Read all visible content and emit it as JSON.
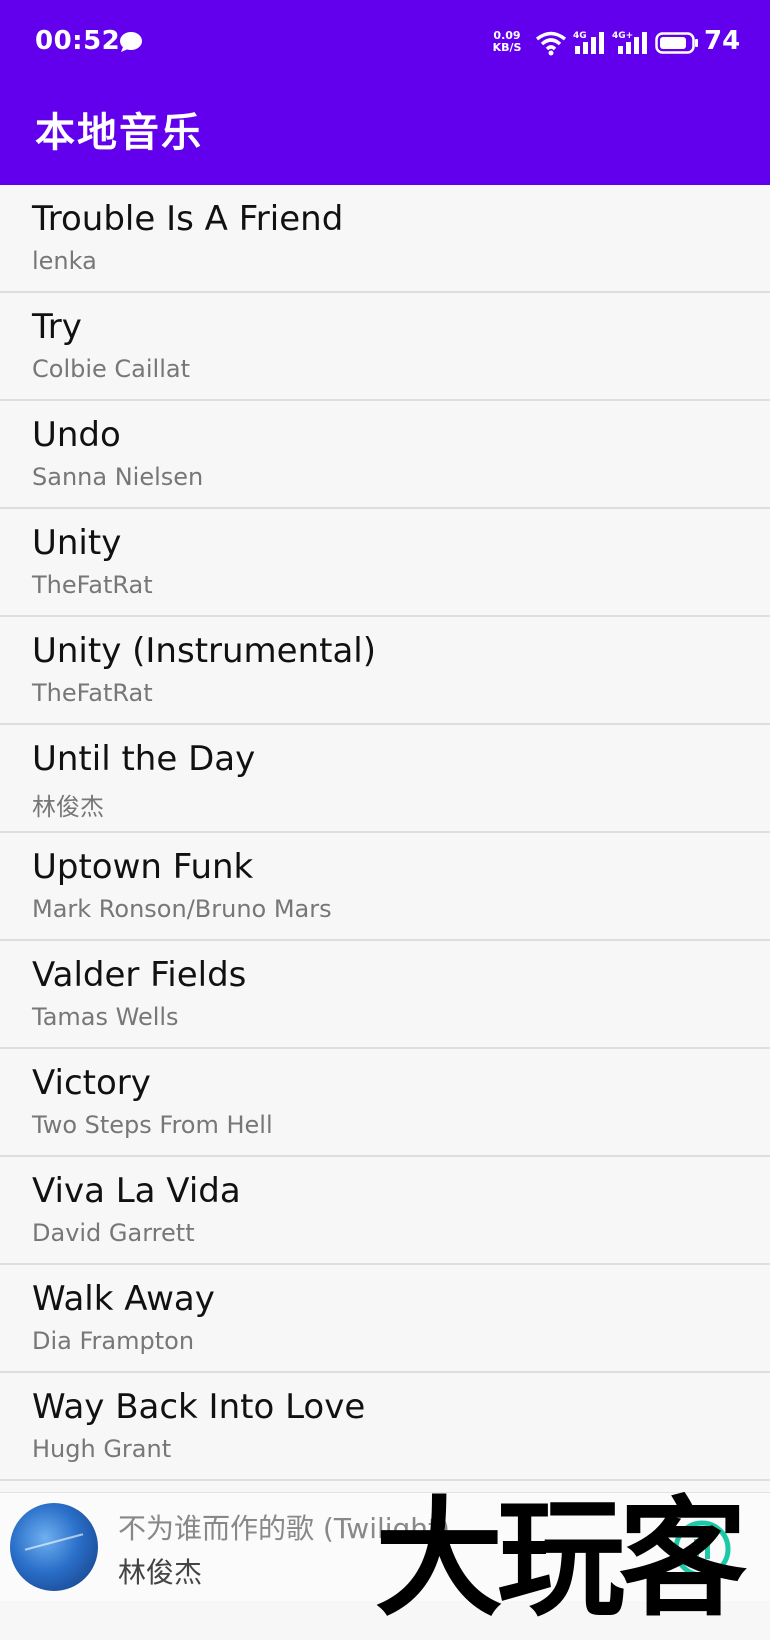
{
  "status_bar": {
    "time": "00:52",
    "net_speed_value": "0.09",
    "net_speed_unit": "KB/S",
    "signal1_label": "4G",
    "signal2_label": "4G+",
    "battery_level": "74"
  },
  "app_bar": {
    "title": "本地音乐"
  },
  "songs": [
    {
      "title": "Trouble Is A Friend",
      "artist": "lenka"
    },
    {
      "title": "Try",
      "artist": "Colbie Caillat"
    },
    {
      "title": "Undo",
      "artist": "Sanna Nielsen"
    },
    {
      "title": "Unity",
      "artist": "TheFatRat"
    },
    {
      "title": "Unity (Instrumental)",
      "artist": "TheFatRat"
    },
    {
      "title": "Until the Day",
      "artist": "林俊杰"
    },
    {
      "title": "Uptown Funk",
      "artist": "Mark Ronson/Bruno Mars"
    },
    {
      "title": "Valder Fields",
      "artist": "Tamas Wells"
    },
    {
      "title": "Victory",
      "artist": "Two Steps From Hell"
    },
    {
      "title": "Viva La Vida",
      "artist": "David Garrett"
    },
    {
      "title": "Walk Away",
      "artist": "Dia Frampton"
    },
    {
      "title": "Way Back Into Love",
      "artist": "Hugh Grant"
    }
  ],
  "now_playing": {
    "title": "不为谁而作的歌 (Twilight)",
    "artist": "林俊杰"
  },
  "watermark": "大玩客",
  "colors": {
    "app_bar": "#6200ee",
    "play_button": "#1bc9a6",
    "list_background": "#f7f7f7"
  }
}
